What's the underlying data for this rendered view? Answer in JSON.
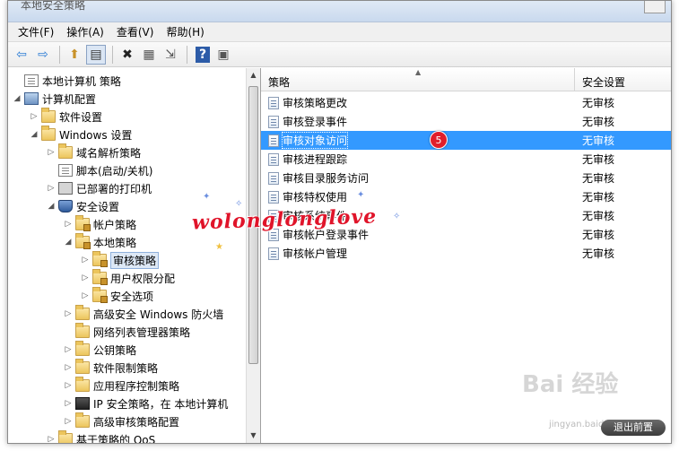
{
  "window": {
    "title": "本地安全策略"
  },
  "menu": [
    "文件(F)",
    "操作(A)",
    "查看(V)",
    "帮助(H)"
  ],
  "toolbar": {
    "buttons": [
      {
        "name": "back-button",
        "glyph": "⇦"
      },
      {
        "name": "forward-button",
        "glyph": "⇨"
      },
      {
        "name": "up-button",
        "glyph": "⬆"
      },
      {
        "name": "show-hide-tree-button",
        "glyph": "▤"
      },
      {
        "name": "delete-button",
        "glyph": "✖"
      },
      {
        "name": "properties-button",
        "glyph": "▦"
      },
      {
        "name": "export-button",
        "glyph": "⇲"
      },
      {
        "name": "help-button",
        "glyph": "?"
      },
      {
        "name": "view-button",
        "glyph": "▣"
      }
    ]
  },
  "tree": [
    {
      "label": "本地计算机 策略",
      "level": 0,
      "arrow": "",
      "icon": "doc"
    },
    {
      "label": "计算机配置",
      "level": 0,
      "arrow": "◢",
      "icon": "computer"
    },
    {
      "label": "软件设置",
      "level": 1,
      "arrow": "▷",
      "icon": "folder"
    },
    {
      "label": "Windows 设置",
      "level": 1,
      "arrow": "◢",
      "icon": "folder"
    },
    {
      "label": "域名解析策略",
      "level": 2,
      "arrow": "▷",
      "icon": "folder"
    },
    {
      "label": "脚本(启动/关机)",
      "level": 2,
      "arrow": "",
      "icon": "doc"
    },
    {
      "label": "已部署的打印机",
      "level": 2,
      "arrow": "▷",
      "icon": "printer"
    },
    {
      "label": "安全设置",
      "level": 2,
      "arrow": "◢",
      "icon": "shield"
    },
    {
      "label": "帐户策略",
      "level": 3,
      "arrow": "▷",
      "icon": "lockfolder"
    },
    {
      "label": "本地策略",
      "level": 3,
      "arrow": "◢",
      "icon": "lockfolder"
    },
    {
      "label": "审核策略",
      "level": 4,
      "arrow": "▷",
      "icon": "lockfolder",
      "selected": true
    },
    {
      "label": "用户权限分配",
      "level": 4,
      "arrow": "▷",
      "icon": "lockfolder"
    },
    {
      "label": "安全选项",
      "level": 4,
      "arrow": "▷",
      "icon": "lockfolder"
    },
    {
      "label": "高级安全 Windows 防火墙",
      "level": 3,
      "arrow": "▷",
      "icon": "folder"
    },
    {
      "label": "网络列表管理器策略",
      "level": 3,
      "arrow": "",
      "icon": "folder"
    },
    {
      "label": "公钥策略",
      "level": 3,
      "arrow": "▷",
      "icon": "folder"
    },
    {
      "label": "软件限制策略",
      "level": 3,
      "arrow": "▷",
      "icon": "folder"
    },
    {
      "label": "应用程序控制策略",
      "level": 3,
      "arrow": "▷",
      "icon": "folder"
    },
    {
      "label": "IP 安全策略，在 本地计算机",
      "level": 3,
      "arrow": "▷",
      "icon": "monitor"
    },
    {
      "label": "高级审核策略配置",
      "level": 3,
      "arrow": "▷",
      "icon": "folder"
    },
    {
      "label": "基于策略的 QoS",
      "level": 2,
      "arrow": "▷",
      "icon": "folder"
    }
  ],
  "list": {
    "columns": {
      "policy": "策略",
      "setting": "安全设置"
    },
    "rows": [
      {
        "policy": "审核策略更改",
        "setting": "无审核"
      },
      {
        "policy": "审核登录事件",
        "setting": "无审核"
      },
      {
        "policy": "审核对象访问",
        "setting": "无审核",
        "selected": true
      },
      {
        "policy": "审核进程跟踪",
        "setting": "无审核"
      },
      {
        "policy": "审核目录服务访问",
        "setting": "无审核"
      },
      {
        "policy": "审核特权使用",
        "setting": "无审核"
      },
      {
        "policy": "审核系统事件",
        "setting": "无审核"
      },
      {
        "policy": "审核帐户登录事件",
        "setting": "无审核"
      },
      {
        "policy": "审核帐户管理",
        "setting": "无审核"
      }
    ]
  },
  "annotation": {
    "step_badge": "5",
    "watermark": "wolonglonglove"
  },
  "overlay": {
    "brand": "Bai 经验",
    "url": "jingyan.baidu.com",
    "exit_button": "退出前置"
  },
  "colors": {
    "selection": "#3399ff",
    "badge": "#e01e2b",
    "watermark": "#e0142a"
  }
}
